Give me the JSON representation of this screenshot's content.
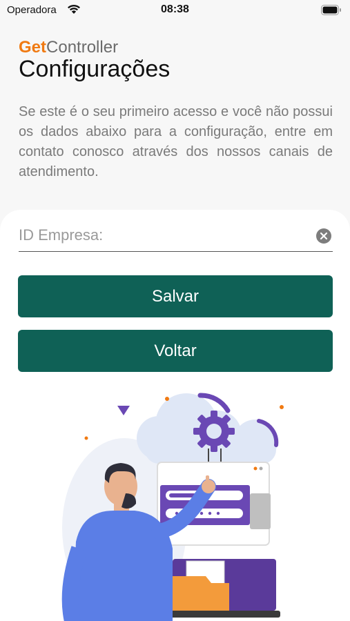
{
  "status_bar": {
    "carrier": "Operadora",
    "time": "08:38"
  },
  "brand": {
    "get": "Get",
    "controller": "Controller"
  },
  "page": {
    "title": "Configurações",
    "intro": "Se este é o seu primeiro acesso e você não possui os dados abaixo para a configuração, entre em contato conosco através dos nossos canais de atendimento."
  },
  "form": {
    "company_id": {
      "value": "",
      "placeholder": "ID Empresa:"
    },
    "save_label": "Salvar",
    "back_label": "Voltar"
  },
  "icons": {
    "wifi": "wifi-icon",
    "battery": "battery-icon",
    "clear": "clear-icon"
  },
  "colors": {
    "brand_orange": "#f07a12",
    "button_green": "#0f6156",
    "illustration_purple": "#6a48b4",
    "illustration_blue": "#5b7ee6"
  }
}
